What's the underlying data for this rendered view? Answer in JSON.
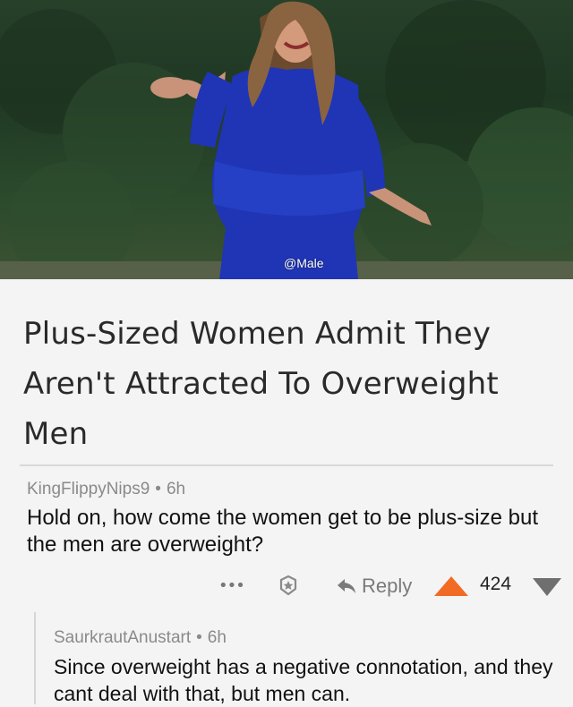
{
  "photo": {
    "watermark": "@Male"
  },
  "article": {
    "title": "Plus-Sized Women Admit They Aren't Attracted To Overweight Men"
  },
  "comments": [
    {
      "author": "KingFlippyNips9",
      "separator": "•",
      "age": "6h",
      "text": "Hold on, how come the women get to be plus-size but the men are overweight?"
    },
    {
      "author": "SaurkrautAnustart",
      "separator": "•",
      "age": "6h",
      "text": "Since overweight has a negative connotation, and they cant deal with that, but men can."
    }
  ],
  "actions": {
    "more_icon": "more-dots-icon",
    "more_glyph": "•••",
    "award_icon": "award-icon",
    "reply_icon": "reply-arrow-icon",
    "reply_label": "Reply",
    "upvote_icon": "upvote-arrow-icon",
    "score": "424",
    "downvote_icon": "downvote-arrow-icon"
  },
  "colors": {
    "upvote": "#f26b24",
    "downvote": "#6f6f6f",
    "dress": "#1f35b5",
    "foliage": "#27402a"
  }
}
